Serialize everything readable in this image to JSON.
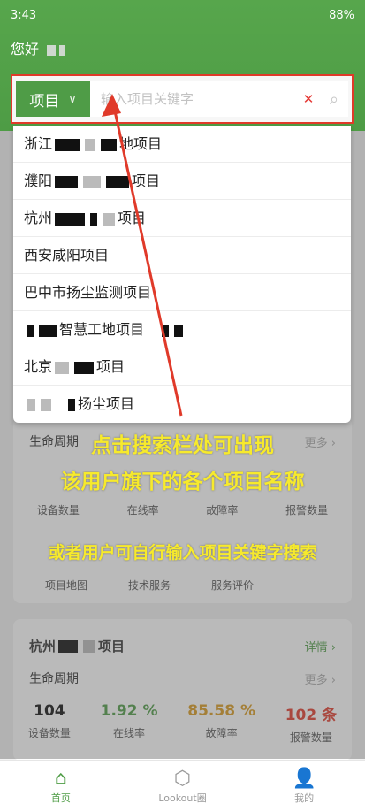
{
  "status_bar": {
    "time": "3:43",
    "battery": "88%"
  },
  "header": {
    "greeting": "您好"
  },
  "search": {
    "scope_label": "项目",
    "placeholder": "输入项目关键字",
    "clear_icon": "close-icon",
    "search_icon": "search-icon"
  },
  "dropdown": {
    "items": [
      "浙江",
      "濮阳",
      "杭州",
      "西安咸阳项目",
      "巴中市扬尘监测项目",
      "智慧工地项目",
      "北京",
      "扬尘项目"
    ],
    "suffixes": [
      "地项目",
      "项目",
      "项目",
      "",
      "",
      "",
      "项目",
      ""
    ]
  },
  "annotation": {
    "line1": "点击搜索栏处可出现",
    "line2": "该用户旗下的各个项目名称",
    "line3": "或者用户可自行输入项目关键字搜索",
    "color": "#f7ea2c",
    "arrow_color": "#e03a2a"
  },
  "card1": {
    "lifecycle_label": "生命周期",
    "more_label": "更多",
    "stats_labels": [
      "设备数量",
      "在线率",
      "故障率",
      "报警数量"
    ],
    "service_labels": [
      "项目地图",
      "技术服务",
      "服务评价"
    ]
  },
  "card2": {
    "title": "杭州",
    "title_suffix": "项目",
    "detail_label": "详情",
    "lifecycle_label": "生命周期",
    "more_label": "更多",
    "stats": [
      {
        "value": "104",
        "label": "设备数量",
        "color": "#111111"
      },
      {
        "value": "1.92 %",
        "label": "在线率",
        "color": "#4e9c45"
      },
      {
        "value": "85.58 %",
        "label": "故障率",
        "color": "#d99a1e"
      },
      {
        "value": "102 条",
        "label": "报警数量",
        "color": "#e23b2c"
      }
    ]
  },
  "tabbar": {
    "items": [
      {
        "label": "首页",
        "icon": "home-icon"
      },
      {
        "label": "Lookout圈",
        "icon": "lookout-icon"
      },
      {
        "label": "我的",
        "icon": "user-icon"
      }
    ]
  }
}
